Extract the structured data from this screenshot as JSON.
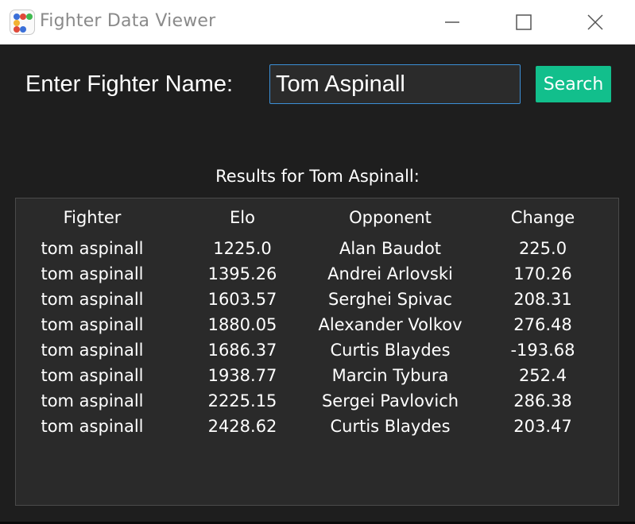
{
  "window": {
    "title": "Fighter Data Viewer",
    "icon": "app-dots-icon",
    "controls": [
      "minimize-icon",
      "maximize-icon",
      "close-icon"
    ]
  },
  "search": {
    "label": "Enter Fighter Name:",
    "value": "Tom Aspinall",
    "button_label": "Search"
  },
  "results": {
    "label": "Results for Tom Aspinall:",
    "columns": [
      "Fighter",
      "Elo",
      "Opponent",
      "Change"
    ],
    "rows": [
      [
        "tom aspinall",
        "1225.0",
        "Alan Baudot",
        "225.0"
      ],
      [
        "tom aspinall",
        "1395.26",
        "Andrei Arlovski",
        "170.26"
      ],
      [
        "tom aspinall",
        "1603.57",
        "Serghei Spivac",
        "208.31"
      ],
      [
        "tom aspinall",
        "1880.05",
        "Alexander Volkov",
        "276.48"
      ],
      [
        "tom aspinall",
        "1686.37",
        "Curtis Blaydes",
        "-193.68"
      ],
      [
        "tom aspinall",
        "1938.77",
        "Marcin Tybura",
        "252.4"
      ],
      [
        "tom aspinall",
        "2225.15",
        "Sergei Pavlovich",
        "286.38"
      ],
      [
        "tom aspinall",
        "2428.62",
        "Curtis Blaydes",
        "203.47"
      ]
    ]
  },
  "colors": {
    "background": "#1e1e1e",
    "panel": "#2a2a2a",
    "accent_button": "#12bf8c",
    "input_border": "#3c8fd6",
    "icon_dots": [
      "#3a6fd8",
      "#e0493a",
      "#3fb950",
      "#f2b233",
      "#e0493a",
      "#3a6fd8"
    ]
  }
}
